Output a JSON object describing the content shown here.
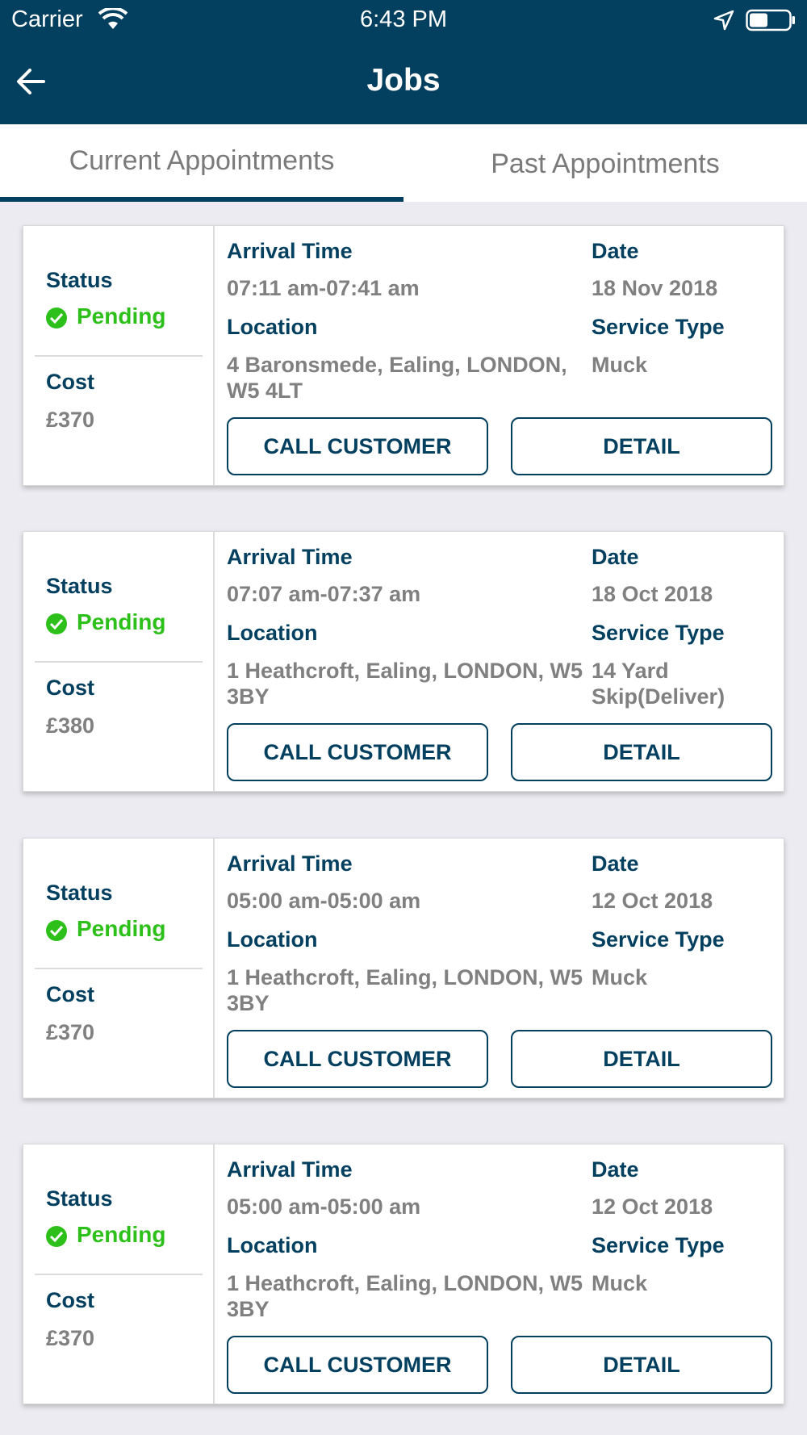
{
  "status_bar": {
    "carrier": "Carrier",
    "time": "6:43 PM",
    "icons": [
      "wifi-icon",
      "location-arrow-icon",
      "battery-icon"
    ]
  },
  "nav": {
    "title": "Jobs",
    "back_icon": "back-arrow-icon"
  },
  "tabs": [
    {
      "label": "Current Appointments",
      "selected": true
    },
    {
      "label": "Past Appointments",
      "selected": false
    }
  ],
  "labels": {
    "status": "Status",
    "cost": "Cost",
    "arrival_time": "Arrival Time",
    "date": "Date",
    "location": "Location",
    "service_type": "Service Type",
    "call_customer": "CALL CUSTOMER",
    "detail": "DETAIL"
  },
  "appointments": [
    {
      "status": "Pending",
      "cost": "£370",
      "arrival_time": "07:11 am-07:41 am",
      "date": "18 Nov 2018",
      "location": "4 Baronsmede, Ealing, LONDON, W5 4LT",
      "service_type": "Muck"
    },
    {
      "status": "Pending",
      "cost": "£380",
      "arrival_time": "07:07 am-07:37 am",
      "date": "18 Oct 2018",
      "location": "1 Heathcroft, Ealing, LONDON, W5 3BY",
      "service_type": "14 Yard Skip(Deliver)"
    },
    {
      "status": "Pending",
      "cost": "£370",
      "arrival_time": "05:00 am-05:00 am",
      "date": "12 Oct 2018",
      "location": "1 Heathcroft, Ealing, LONDON, W5 3BY",
      "service_type": "Muck"
    },
    {
      "status": "Pending",
      "cost": "£370",
      "arrival_time": "05:00 am-05:00 am",
      "date": "12 Oct 2018",
      "location": "1 Heathcroft, Ealing, LONDON, W5 3BY",
      "service_type": "Muck"
    }
  ],
  "colors": {
    "primary": "#033f5e",
    "status_pending": "#2ec01a",
    "value_text": "#808080",
    "background": "#ebebf1"
  }
}
